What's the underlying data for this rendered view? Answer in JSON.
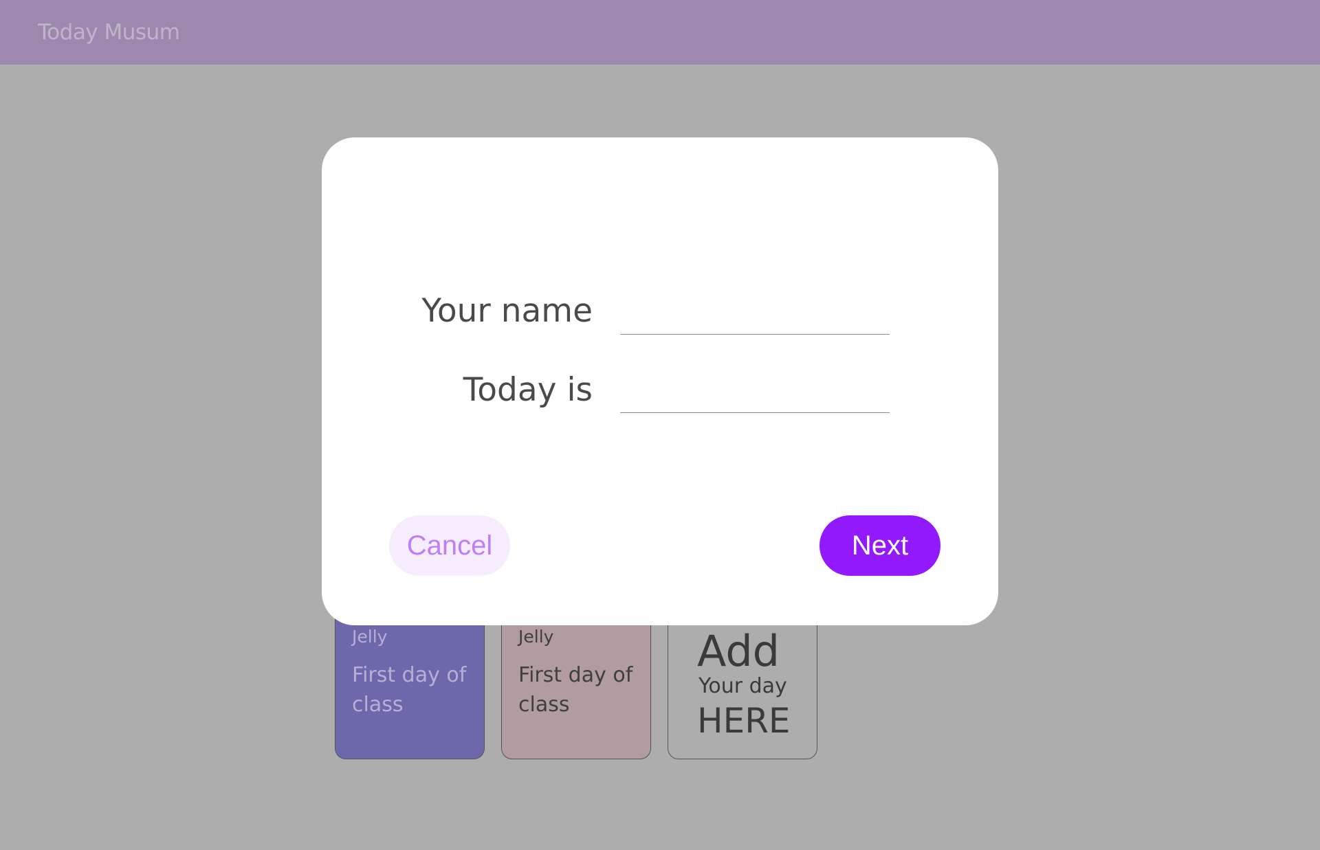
{
  "header": {
    "title": "Today Musum"
  },
  "cards": [
    {
      "author": "Jelly",
      "text": "First day of class",
      "color": "#6d67ac"
    },
    {
      "author": "Jelly",
      "text": "First day of class",
      "color": "#b19ca0"
    }
  ],
  "add_card": {
    "big": "Add",
    "small": "Your day",
    "here": "HERE"
  },
  "dialog": {
    "name_label": "Your name",
    "name_value": "",
    "today_label": "Today is",
    "today_value": "",
    "cancel_label": "Cancel",
    "next_label": "Next"
  },
  "colors": {
    "accent": "#9219fb",
    "header_bg": "#9d89ae",
    "overlay": "#adadad"
  }
}
